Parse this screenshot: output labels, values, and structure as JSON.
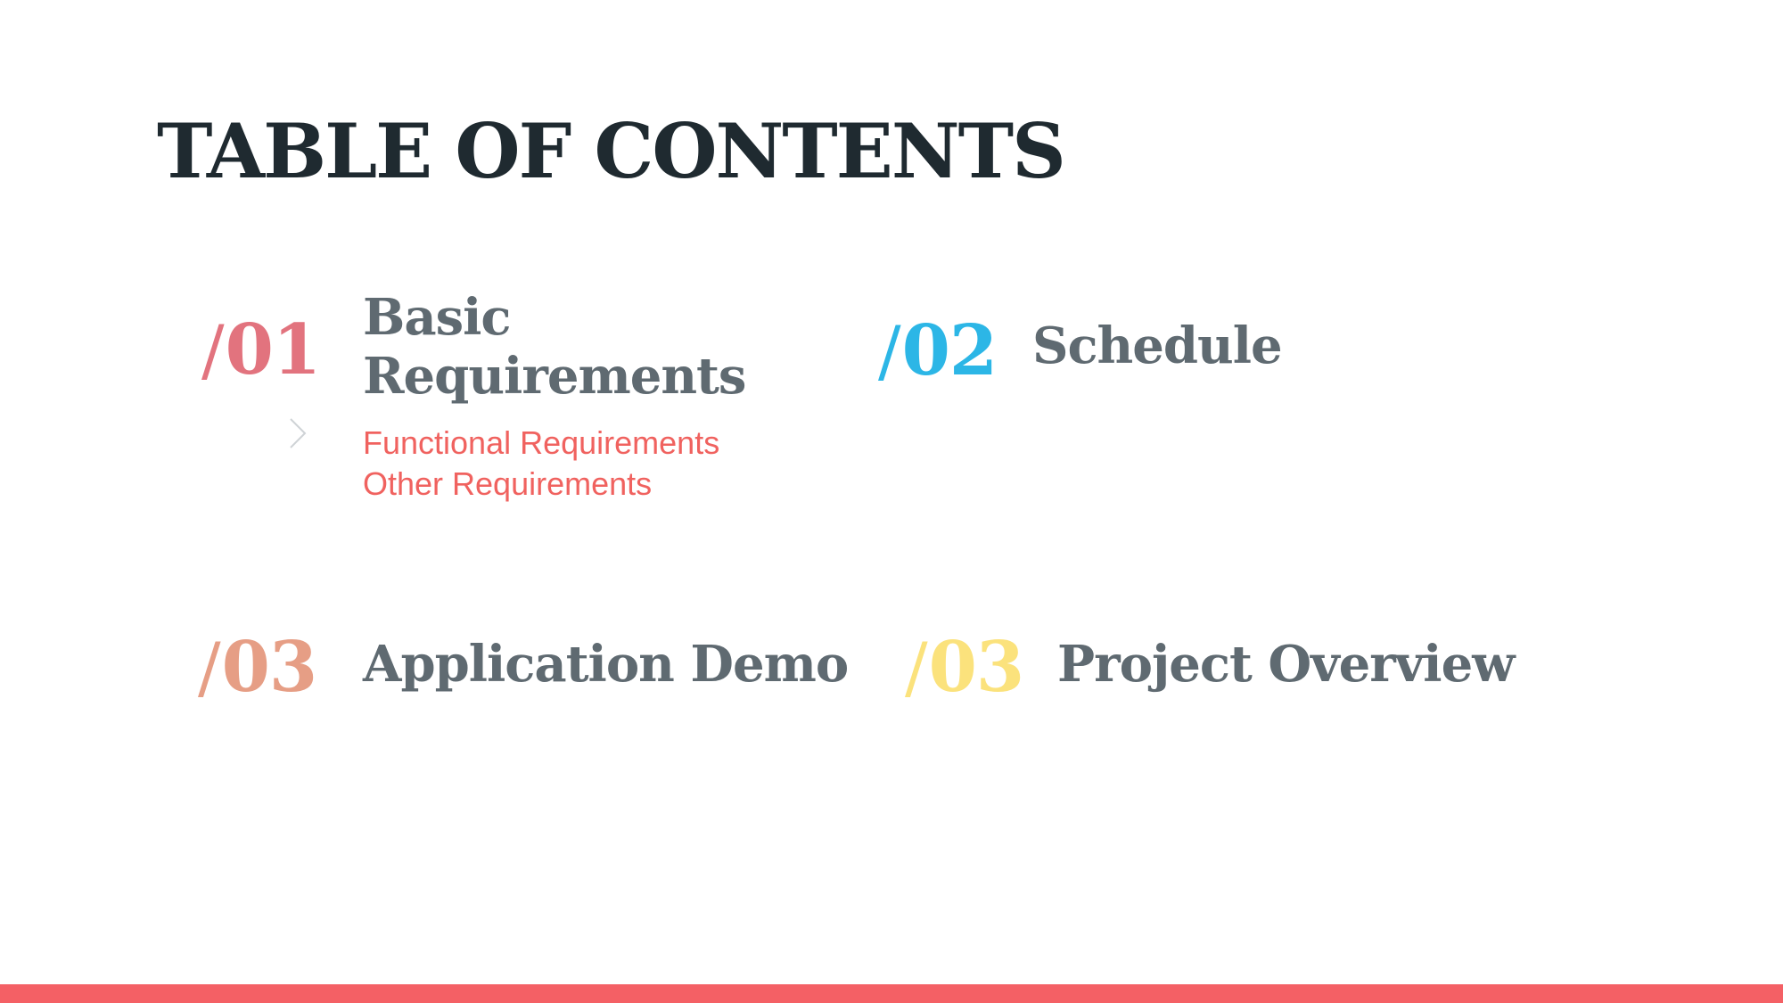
{
  "title": "TABLE OF CONTENTS",
  "sections": [
    {
      "number": "01",
      "slash": "/",
      "heading_line1": "Basic",
      "heading_line2": "Requirements",
      "color": "#e2737e",
      "subitems": [
        "Functional Requirements",
        "Other Requirements"
      ]
    },
    {
      "number": "02",
      "slash": "/",
      "heading": "Schedule",
      "color": "#2cb6e6"
    },
    {
      "number": "03",
      "slash": "/",
      "heading": "Application Demo",
      "color": "#e69e85"
    },
    {
      "number": "03",
      "slash": "/",
      "heading": "Project Overview",
      "color": "#fbe27c"
    }
  ],
  "colors": {
    "title": "#1f2a30",
    "heading": "#5f6a71",
    "subitem": "#f0625f",
    "bottom_bar": "#f46065",
    "chevron": "#cfd3d6"
  },
  "icons": {
    "subitem_marker": "chevron-right-icon"
  }
}
